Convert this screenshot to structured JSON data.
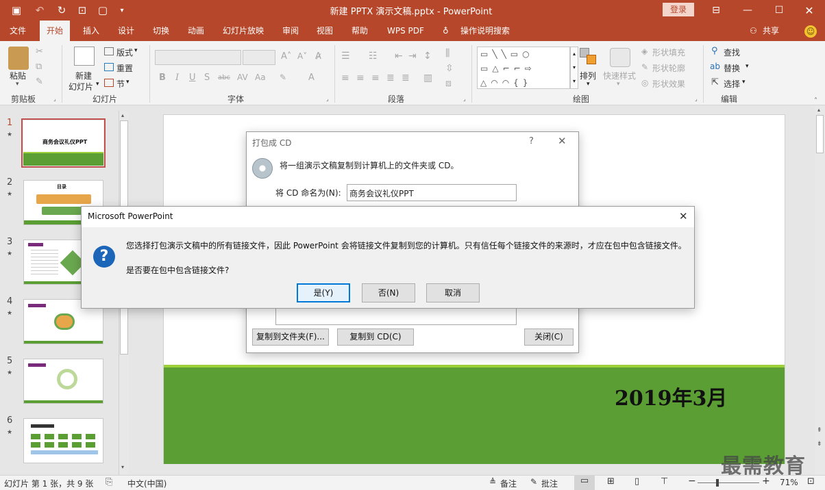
{
  "app": {
    "title": "新建 PPTX 演示文稿.pptx  -  PowerPoint",
    "login_label": "登录",
    "accent": "#b7472a"
  },
  "tabs": [
    "文件",
    "开始",
    "插入",
    "设计",
    "切换",
    "动画",
    "幻灯片放映",
    "审阅",
    "视图",
    "帮助",
    "WPS PDF",
    "操作说明搜索"
  ],
  "share_label": "共享",
  "ribbon": {
    "clipboard": {
      "paste": "粘贴",
      "group": "剪贴板"
    },
    "slides": {
      "new_slide_1": "新建",
      "new_slide_2": "幻灯片",
      "layout": "版式",
      "reset": "重置",
      "section": "节",
      "group": "幻灯片"
    },
    "font": {
      "group": "字体"
    },
    "paragraph": {
      "group": "段落"
    },
    "drawing": {
      "arrange": "排列",
      "quick_styles": "快速样式",
      "shape_fill": "形状填充",
      "shape_outline": "形状轮廓",
      "shape_effects": "形状效果",
      "group": "绘图"
    },
    "editing": {
      "find": "查找",
      "replace": "替换",
      "select": "选择",
      "group": "编辑"
    }
  },
  "thumbnails": [
    {
      "num": "1",
      "title": "商务会议礼仪PPT"
    },
    {
      "num": "2",
      "title": "目录"
    },
    {
      "num": "3"
    },
    {
      "num": "4"
    },
    {
      "num": "5"
    },
    {
      "num": "6"
    }
  ],
  "slide": {
    "date": "2019年3月"
  },
  "cd_dialog": {
    "title": "打包成 CD",
    "help": "?",
    "description": "将一组演示文稿复制到计算机上的文件夹或 CD。",
    "name_label": "将 CD 命名为(N):",
    "name_value": "商务会议礼仪PPT",
    "copy_to_folder": "复制到文件夹(F)...",
    "copy_to_cd": "复制到 CD(C)",
    "close": "关闭(C)"
  },
  "msg_dialog": {
    "title": "Microsoft PowerPoint",
    "message": "您选择打包演示文稿中的所有链接文件，因此 PowerPoint 会将链接文件复制到您的计算机。只有信任每个链接文件的来源时，才应在包中包含链接文件。",
    "question": "是否要在包中包含链接文件?",
    "yes": "是(Y)",
    "no": "否(N)",
    "cancel": "取消"
  },
  "status": {
    "slide_info": "幻灯片 第 1 张，共 9 张",
    "language": "中文(中国)",
    "notes": "备注",
    "comments": "批注",
    "zoom": "71%"
  },
  "watermark": "最需教育"
}
